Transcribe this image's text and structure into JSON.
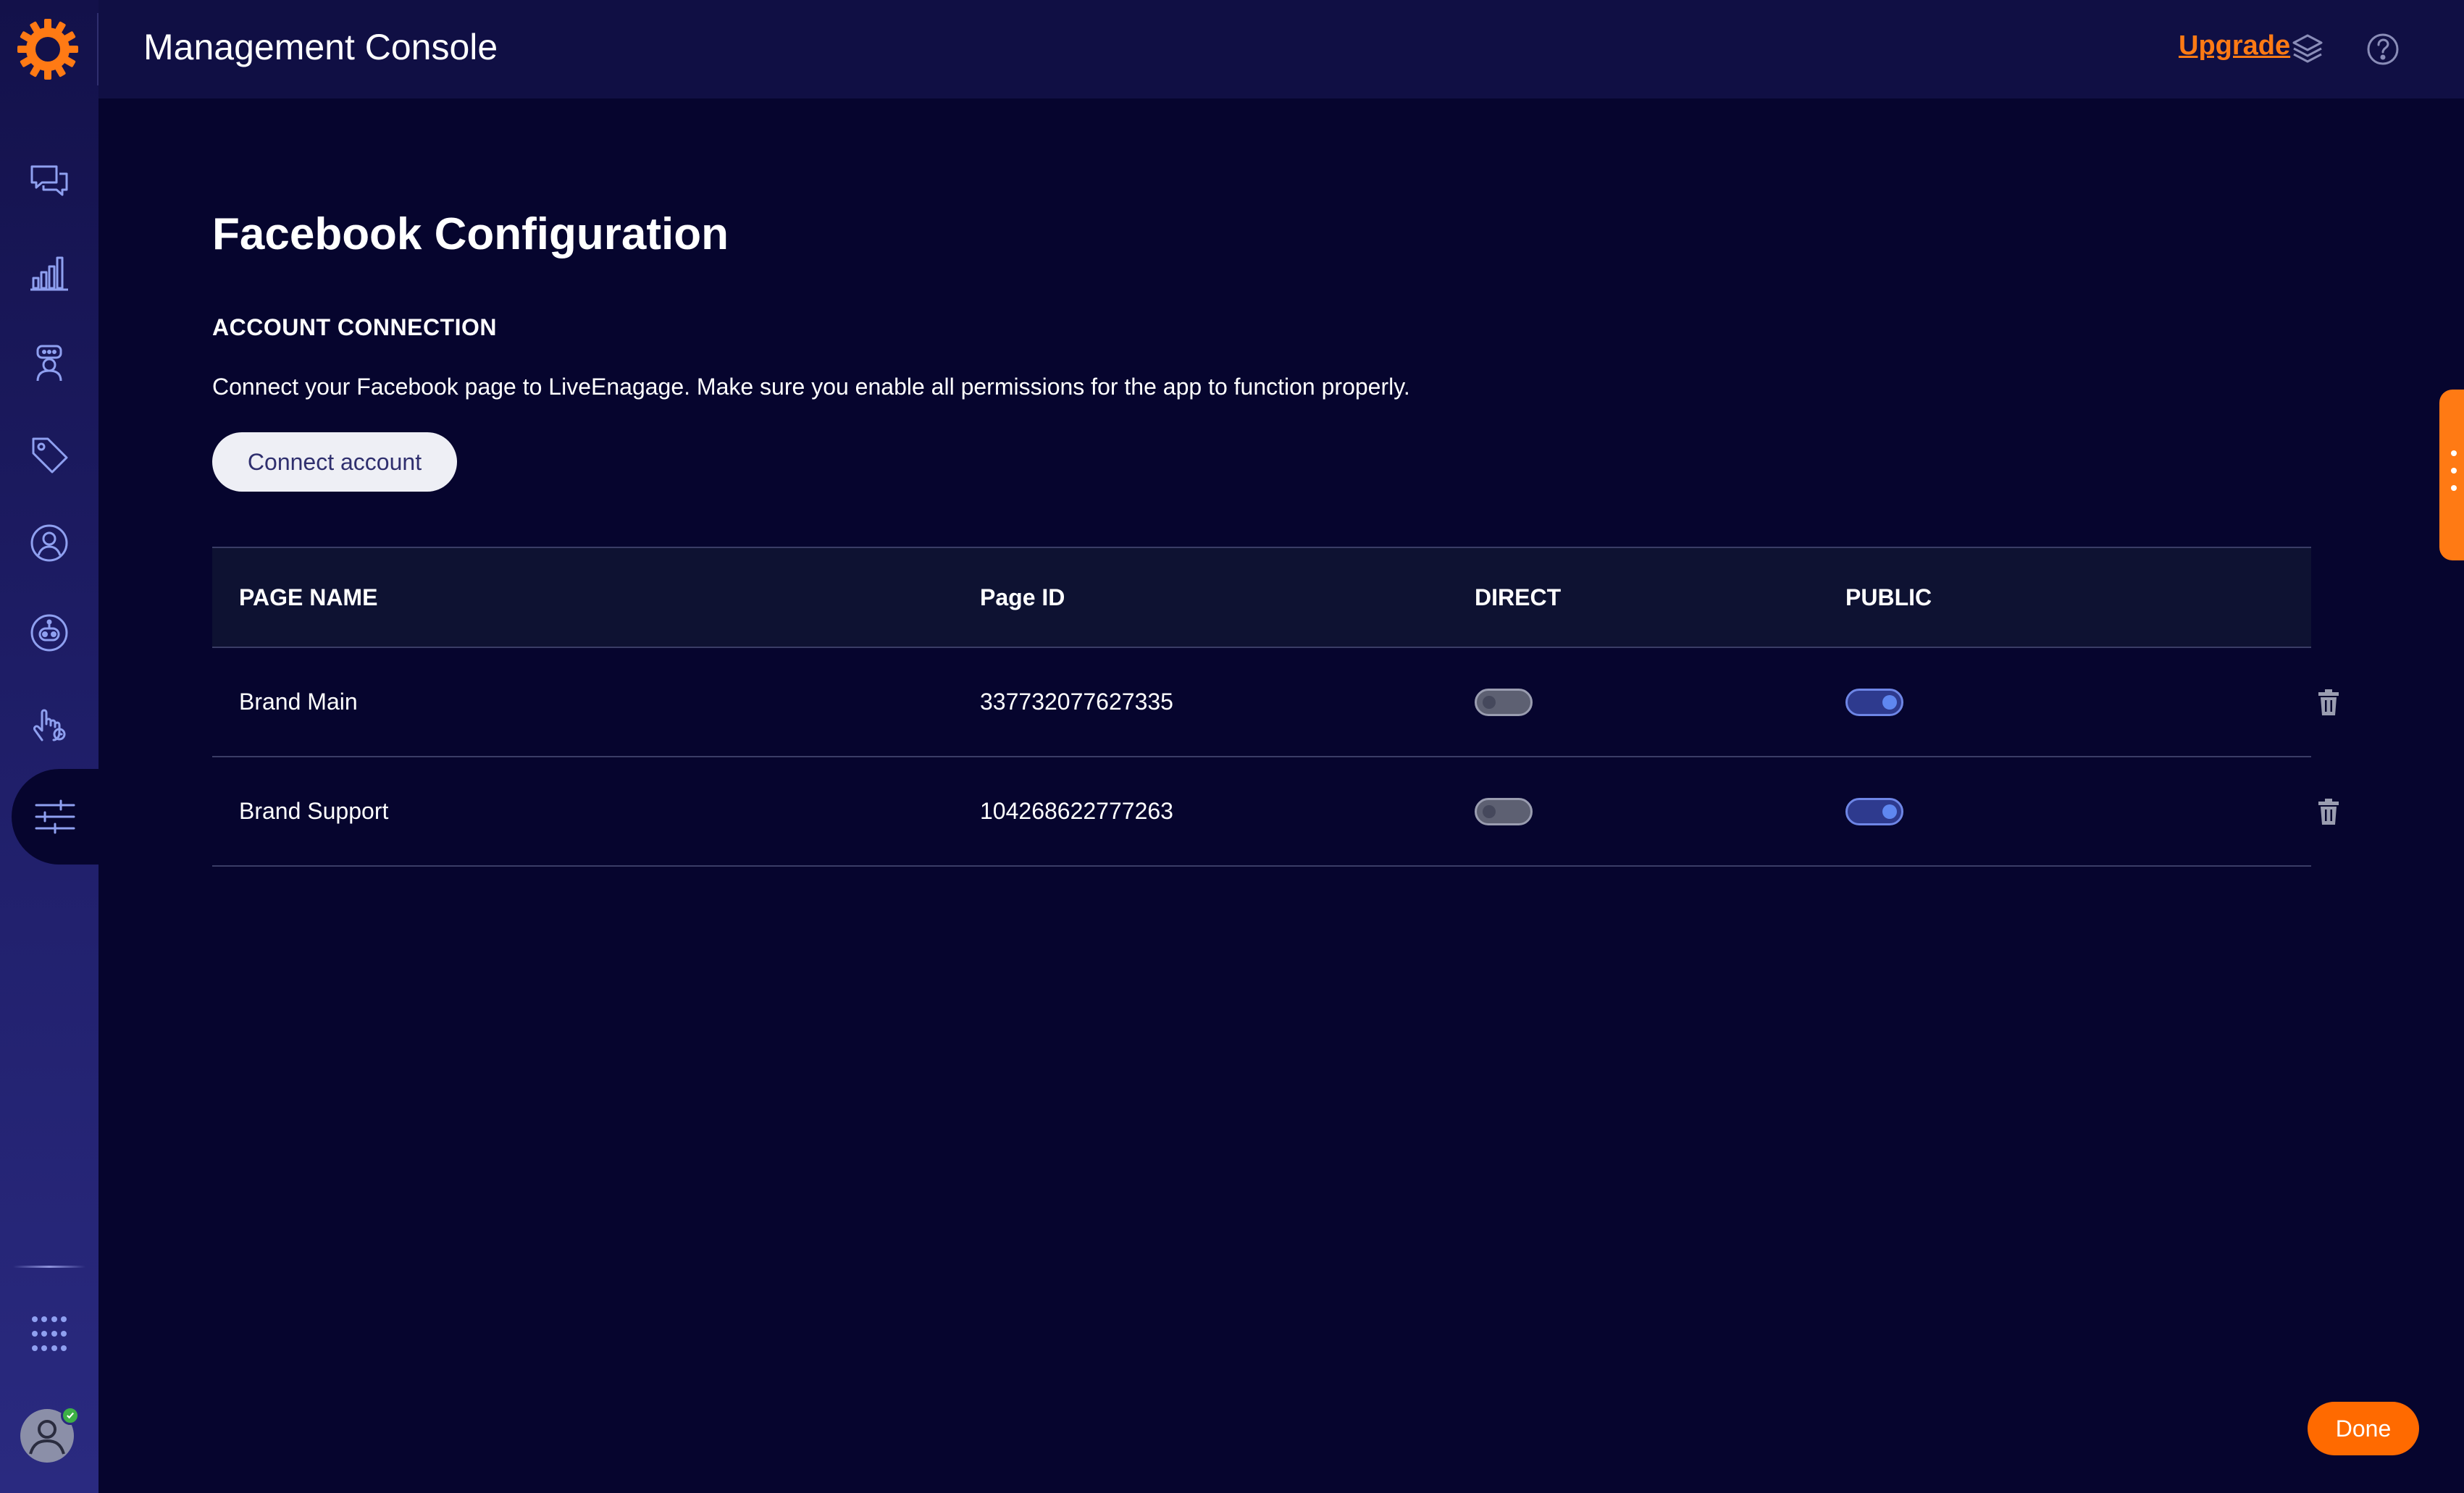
{
  "app": {
    "title": "Management Console",
    "upgrade_label": "Upgrade"
  },
  "icons": {
    "logo": "sun-logo-icon",
    "layers": "layers-icon",
    "help": "help-icon"
  },
  "sidebar": {
    "items": [
      {
        "name": "conversations",
        "icon": "chat-bubbles-icon",
        "active": false
      },
      {
        "name": "analytics",
        "icon": "bar-chart-icon",
        "active": false
      },
      {
        "name": "agents",
        "icon": "agent-headset-icon",
        "active": false
      },
      {
        "name": "tags",
        "icon": "tag-icon",
        "active": false
      },
      {
        "name": "users",
        "icon": "user-circle-icon",
        "active": false
      },
      {
        "name": "bots",
        "icon": "bot-icon",
        "active": false
      },
      {
        "name": "automation",
        "icon": "hand-touch-icon",
        "active": false
      },
      {
        "name": "management",
        "icon": "sliders-icon",
        "active": true
      }
    ],
    "apps_icon": "apps-grid-icon",
    "user_status": "online"
  },
  "page": {
    "title": "Facebook Configuration",
    "section_heading": "ACCOUNT CONNECTION",
    "description": "Connect your Facebook page to LiveEnagage. Make sure you enable all permissions for the app to function properly.",
    "connect_button": "Connect account"
  },
  "table": {
    "headers": {
      "page_name": "PAGE NAME",
      "page_id": "Page ID",
      "direct": "DIRECT",
      "public": "PUBLIC"
    },
    "rows": [
      {
        "page_name": "Brand Main",
        "page_id": "337732077627335",
        "direct": false,
        "public": true
      },
      {
        "page_name": "Brand Support",
        "page_id": "104268622777263",
        "direct": false,
        "public": true
      }
    ]
  },
  "footer": {
    "done_button": "Done"
  },
  "colors": {
    "accent": "#ff6a00",
    "link": "#ff7a14",
    "background": "#06052e",
    "sidebar": "#1e1d66",
    "toggle_on": "#5f87f0",
    "toggle_off": "#5d6072",
    "success": "#3db046"
  }
}
